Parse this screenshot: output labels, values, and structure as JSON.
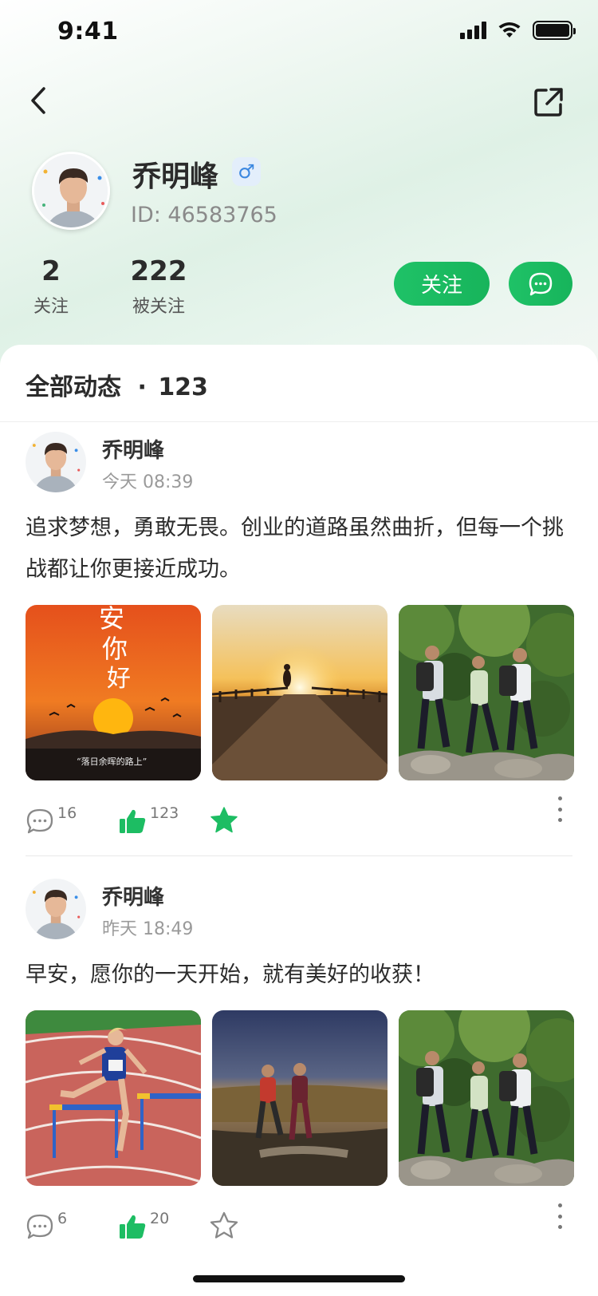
{
  "status_bar": {
    "time": "9:41"
  },
  "profile": {
    "name": "乔明峰",
    "gender_icon": "male-symbol",
    "id_text": "ID: 46583765",
    "following_count": "2",
    "following_label": "关注",
    "followers_count": "222",
    "followers_label": "被关注",
    "follow_button_label": "关注"
  },
  "feed": {
    "title": "全部动态",
    "separator": "·",
    "count": "123",
    "posts": [
      {
        "author": "乔明峰",
        "time": "今天 08:39",
        "text": "追求梦想，勇敢无畏。创业的道路虽然曲折，但每一个挑战都让你更接近成功。",
        "images": [
          "sunset-birds-poster",
          "pier-runner-sunset",
          "forest-hikers"
        ],
        "image_poster_text": [
          "安",
          "你",
          "好"
        ],
        "image_poster_caption": "“落日余晖的路上”",
        "comments": "16",
        "likes": "123",
        "favorited": true
      },
      {
        "author": "乔明峰",
        "time": "昨天 18:49",
        "text": "早安，愿你的一天开始，就有美好的收获！",
        "images": [
          "hurdle-runner-track",
          "couple-running-dusk",
          "forest-hikers"
        ],
        "comments": "6",
        "likes": "20",
        "favorited": false
      }
    ]
  },
  "colors": {
    "accent": "#1dbd63",
    "gender_blue": "#3a87e0",
    "text_primary": "#2b2b2b",
    "text_muted": "#9a9a9a"
  }
}
